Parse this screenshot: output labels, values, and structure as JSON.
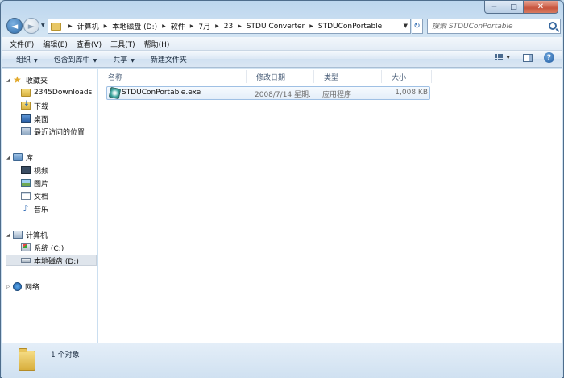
{
  "window": {
    "caption_buttons": {
      "minimize": "─",
      "maximize": "□",
      "close": "✕"
    }
  },
  "navigation": {
    "back_glyph": "◄",
    "forward_glyph": "►",
    "breadcrumb": [
      "计算机",
      "本地磁盘 (D:)",
      "软件",
      "7月",
      "23",
      "STDU Converter",
      "STDUConPortable"
    ],
    "search_placeholder": "搜索 STDUConPortable"
  },
  "menubar": {
    "items": [
      "文件(F)",
      "编辑(E)",
      "查看(V)",
      "工具(T)",
      "帮助(H)"
    ]
  },
  "toolbar": {
    "organize": "组织",
    "include_in_library": "包含到库中",
    "share": "共享",
    "new_folder": "新建文件夹",
    "help_glyph": "?"
  },
  "sidebar": {
    "favorites": {
      "label": "收藏夹",
      "items": [
        "2345Downloads",
        "下载",
        "桌面",
        "最近访问的位置"
      ]
    },
    "libraries": {
      "label": "库",
      "items": [
        "视频",
        "图片",
        "文档",
        "音乐"
      ]
    },
    "computer": {
      "label": "计算机",
      "items": [
        "系统 (C:)",
        "本地磁盘 (D:)"
      ]
    },
    "network": {
      "label": "网络"
    }
  },
  "columns": {
    "name": "名称",
    "date": "修改日期",
    "type": "类型",
    "size": "大小"
  },
  "files": [
    {
      "name": "STDUConPortable.exe",
      "date": "2008/7/14 星期...",
      "type": "应用程序",
      "size": "1,008 KB"
    }
  ],
  "status": {
    "count_text": "1 个对象"
  }
}
